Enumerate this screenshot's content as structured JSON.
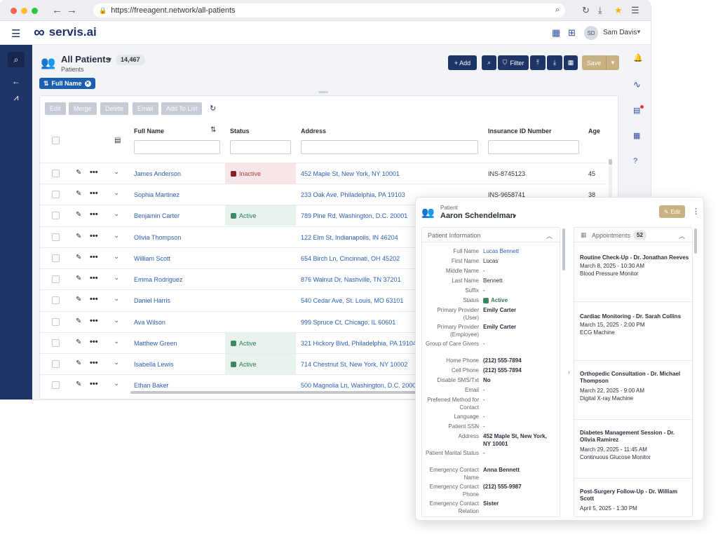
{
  "browser": {
    "url": "https://freeagent.network/all-patients",
    "icons": {
      "back": "arrow-left-icon",
      "forward": "arrow-right-icon",
      "lock": "lock-icon",
      "zoom": "zoom-icon",
      "reload": "reload-icon",
      "download": "download-icon",
      "bookmark": "star-icon",
      "menu": "menu-icon"
    },
    "colors": {
      "close": "#fc5f57",
      "minimize": "#fdbc2e",
      "maximize": "#28c840",
      "bookmark": "#f5b301"
    }
  },
  "header": {
    "logo_text": "servis.ai",
    "user_initials": "SD",
    "user_name": "Sam Davis"
  },
  "page": {
    "title": "All Patients",
    "subtitle": "Patients",
    "count": "14,467",
    "filter_chip": "Full Name"
  },
  "toolbar": {
    "add_label": "+ Add",
    "filter_label": "Filter",
    "save_label": "Save"
  },
  "actions": [
    "Edit",
    "Merge",
    "Delete",
    "Email",
    "Add To List"
  ],
  "columns": {
    "full_name": "Full Name",
    "status": "Status",
    "address": "Address",
    "insurance": "Insurance ID Number",
    "age": "Age"
  },
  "rows": [
    {
      "name": "James Anderson",
      "status": "Inactive",
      "address": "452 Maple St, New York, NY 10001",
      "insurance": "INS-8745123",
      "age": "45"
    },
    {
      "name": "Sophia Martinez",
      "status": "",
      "address": "233 Oak Ave, Philadelphia, PA 19103",
      "insurance": "INS-9658741",
      "age": "38"
    },
    {
      "name": "Benjamin Carter",
      "status": "Active",
      "address": "789 Pine Rd, Washington, D.C. 20001",
      "insurance": "",
      "age": ""
    },
    {
      "name": "Olivia Thompson",
      "status": "",
      "address": "122 Elm St, Indianapolis, IN 46204",
      "insurance": "",
      "age": ""
    },
    {
      "name": "William Scott",
      "status": "",
      "address": "654 Birch Ln, Cincinnati, OH 45202",
      "insurance": "",
      "age": ""
    },
    {
      "name": "Emma Rodriguez",
      "status": "",
      "address": "876 Walnut Dr, Nashville, TN 37201",
      "insurance": "",
      "age": ""
    },
    {
      "name": "Daniel Harris",
      "status": "",
      "address": "540 Cedar Ave, St. Louis, MO 63101",
      "insurance": "",
      "age": ""
    },
    {
      "name": "Ava Wilson",
      "status": "",
      "address": "999 Spruce Ct, Chicago, IL 60601",
      "insurance": "",
      "age": ""
    },
    {
      "name": "Matthew Green",
      "status": "Active",
      "address": "321 Hickory Blvd, Philadelphia, PA 19104",
      "insurance": "",
      "age": ""
    },
    {
      "name": "Isabella Lewis",
      "status": "Active",
      "address": "714 Chestnut St, New York, NY 10002",
      "insurance": "",
      "age": ""
    },
    {
      "name": "Ethan Baker",
      "status": "",
      "address": "500 Magnolia Ln, Washington, D.C. 2000",
      "insurance": "",
      "age": ""
    }
  ],
  "popup": {
    "label": "Patient",
    "name": "Aaron Schendelman",
    "edit_label": "Edit",
    "info_title": "Patient Information",
    "fields": [
      {
        "label": "Full Name",
        "value": "Lucas Bennett",
        "kind": "link"
      },
      {
        "label": "First Name",
        "value": "Lucas",
        "kind": "plain"
      },
      {
        "label": "Middle Name",
        "value": "-",
        "kind": "plain"
      },
      {
        "label": "Last Name",
        "value": "Bennett",
        "kind": "plain"
      },
      {
        "label": "Suffix",
        "value": "-",
        "kind": "plain"
      },
      {
        "label": "Status",
        "value": "Active",
        "kind": "status"
      },
      {
        "label": "Primary Provider (User)",
        "value": "Emily Carter",
        "kind": "bold"
      },
      {
        "label": "Primary Provider (Employee)",
        "value": "Emily Carter",
        "kind": "bold"
      },
      {
        "label": "Group of Care Givers",
        "value": "-",
        "kind": "plain"
      },
      {
        "label": "Home Phone",
        "value": "(212) 555-7894",
        "kind": "bold"
      },
      {
        "label": "Cell Phone",
        "value": "(212) 555-7894",
        "kind": "bold"
      },
      {
        "label": "Disable SMS/Txt",
        "value": "No",
        "kind": "bold"
      },
      {
        "label": "Email",
        "value": "-",
        "kind": "plain"
      },
      {
        "label": "Preferred Method for Contact",
        "value": "-",
        "kind": "plain"
      },
      {
        "label": "Language",
        "value": "-",
        "kind": "plain"
      },
      {
        "label": "Patient SSN",
        "value": "-",
        "kind": "plain"
      },
      {
        "label": "Address",
        "value": "452 Maple St, New York, NY 10001",
        "kind": "bold"
      },
      {
        "label": "Patient Marital Status",
        "value": "-",
        "kind": "plain"
      },
      {
        "label": "Emergency Contact Name",
        "value": "Anna Bennett",
        "kind": "bold"
      },
      {
        "label": "Emergency Contact Phone",
        "value": "(212) 555-9987",
        "kind": "bold"
      },
      {
        "label": "Emergency Contact Relation",
        "value": "Sister",
        "kind": "bold"
      }
    ],
    "appointments_title": "Appointments",
    "appointments_count": "52",
    "appointments": [
      {
        "title": "Routine Check-Up - Dr. Jonathan Reeves",
        "date": "March 8, 2025 - 10:30 AM",
        "device": "Blood Pressure Monitor"
      },
      {
        "title": "Cardiac Monitoring - Dr. Sarah Collins",
        "date": "March 15, 2025 - 2:00 PM",
        "device": "ECG Machine"
      },
      {
        "title": "Orthopedic Consultation - Dr. Michael Thompson",
        "date": "March 22, 2025 - 9:00 AM",
        "device": "Digital X-ray Machine"
      },
      {
        "title": "Diabetes Management Session - Dr. Olivia Ramirez",
        "date": "March 29, 2025 - 11:45 AM",
        "device": "Continuous Glucose Monitor"
      },
      {
        "title": "Post-Surgery Follow-Up - Dr. William Scott",
        "date": "April 5, 2025 - 1:30 PM",
        "device": ""
      }
    ]
  },
  "colors": {
    "brand_navy": "#1f3568",
    "link_blue": "#2b5fb0",
    "save_gold": "#c9b183",
    "inactive_red": "#8a1c24",
    "active_green": "#3a8a65",
    "notification_red": "#e53935"
  }
}
